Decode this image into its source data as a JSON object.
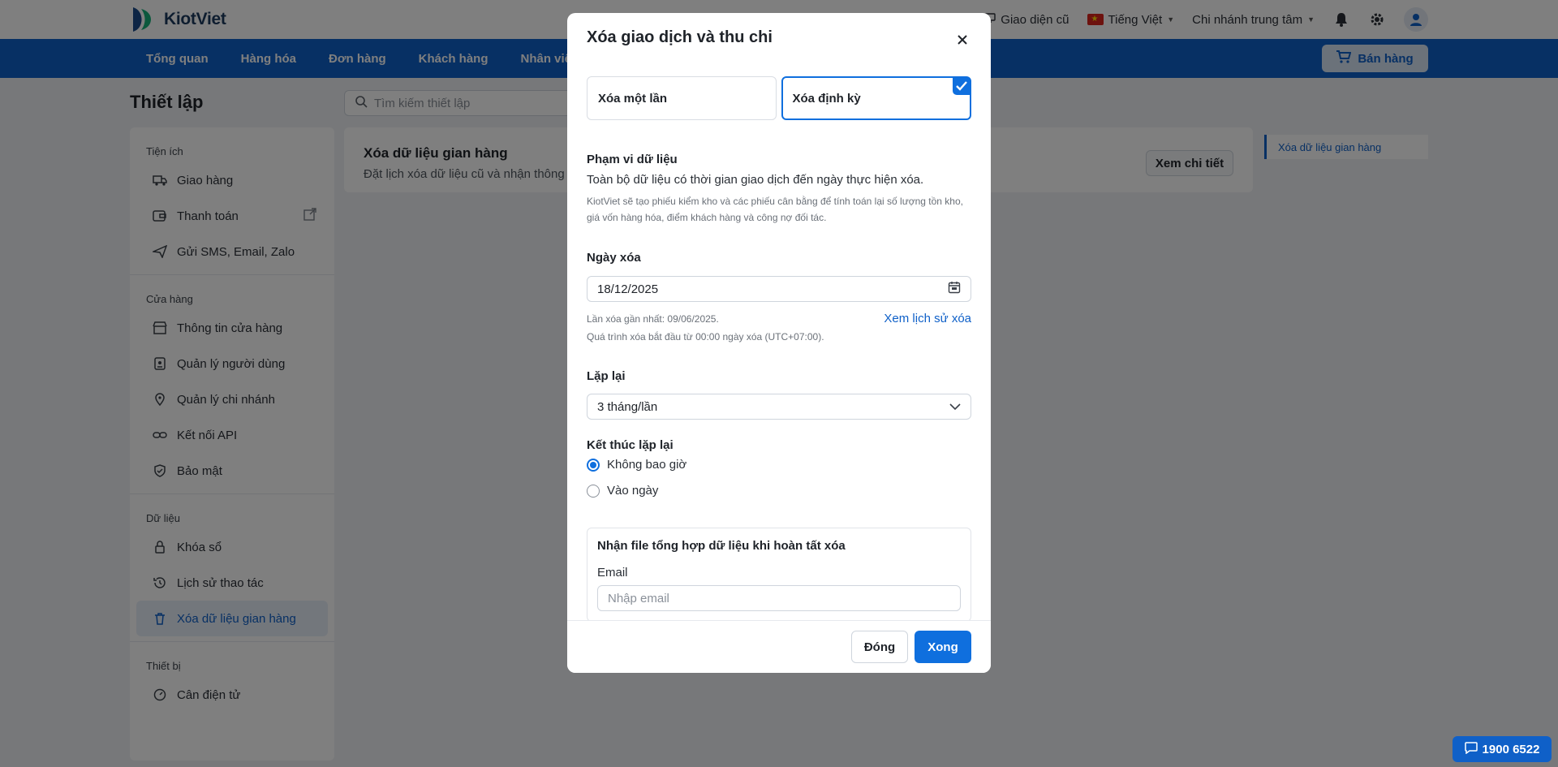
{
  "app": {
    "brand": "KiotViet"
  },
  "topbar": {
    "old_ui": "Giao diện cũ",
    "language": "Tiếng Việt",
    "branch": "Chi nhánh trung tâm"
  },
  "nav": {
    "items": [
      "Tổng quan",
      "Hàng hóa",
      "Đơn hàng",
      "Khách hàng",
      "Nhân viên"
    ],
    "sell_label": "Bán hàng"
  },
  "page": {
    "title": "Thiết lập",
    "search_placeholder": "Tìm kiếm thiết lập"
  },
  "sidebar": {
    "sections": [
      {
        "title": "Tiện ích",
        "items": [
          "Giao hàng",
          "Thanh toán",
          "Gửi SMS, Email, Zalo"
        ]
      },
      {
        "title": "Cửa hàng",
        "items": [
          "Thông tin cửa hàng",
          "Quản lý người dùng",
          "Quản lý chi nhánh",
          "Kết nối API",
          "Bảo mật"
        ]
      },
      {
        "title": "Dữ liệu",
        "items": [
          "Khóa sổ",
          "Lịch sử thao tác",
          "Xóa dữ liệu gian hàng"
        ]
      },
      {
        "title": "Thiết bị",
        "items": [
          "Cân điện tử"
        ]
      }
    ]
  },
  "content": {
    "title": "Xóa dữ liệu gian hàng",
    "description": "Đặt lịch xóa dữ liệu cũ và nhận thông b",
    "detail_button": "Xem chi tiết",
    "toc_item": "Xóa dữ liệu gian hàng"
  },
  "help": {
    "phone": "1900 6522"
  },
  "modal": {
    "title": "Xóa giao dịch và thu chi",
    "options": {
      "once": "Xóa một lần",
      "periodic": "Xóa định kỳ"
    },
    "scope_label": "Phạm vi dữ liệu",
    "scope_text": "Toàn bộ dữ liệu có thời gian giao dịch đến ngày thực hiện xóa.",
    "scope_note": "KiotViet sẽ tạo phiếu kiểm kho và các phiếu cân bằng để tính toán lại số lượng tồn kho, giá vốn hàng hóa, điểm khách hàng và công nợ đối tác.",
    "date_label": "Ngày xóa",
    "date_value": "18/12/2025",
    "last_delete": "Lần xóa gần nhất: 09/06/2025.",
    "process_note": "Quá trình xóa bắt đầu từ 00:00 ngày xóa (UTC+07:00).",
    "history_link": "Xem lịch sử xóa",
    "repeat_label": "Lặp lại",
    "repeat_value": "3 tháng/lần",
    "end_label": "Kết thúc lặp lại",
    "end_never": "Không bao giờ",
    "end_on_date": "Vào ngày",
    "email_title": "Nhận file tổng hợp dữ liệu khi hoàn tất xóa",
    "email_label": "Email",
    "email_placeholder": "Nhập email",
    "close_button": "Đóng",
    "done_button": "Xong"
  },
  "colors": {
    "primary": "#0f60c8",
    "accent": "#0f6fde",
    "overlay": "rgba(0,0,0,0.5)"
  }
}
